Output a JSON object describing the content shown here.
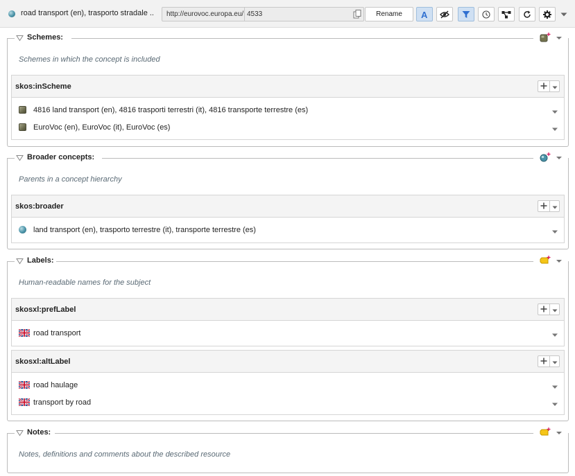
{
  "toolbar": {
    "concept_title": "road transport (en), trasporto stradale ..",
    "uri_base": "http://eurovoc.europa.eu/",
    "uri_id": "4533",
    "rename_label": "Rename",
    "icons": [
      "font-icon",
      "eye-slash-icon",
      "filter-icon",
      "clock-icon",
      "graph-icon",
      "refresh-icon",
      "gear-icon",
      "chevron-down-icon"
    ],
    "active_color": "#cfe0f3"
  },
  "sections": {
    "schemes": {
      "title": "Schemes:",
      "description": "Schemes in which the concept is included",
      "properties": [
        {
          "name": "skos:inScheme",
          "values": [
            "4816 land transport (en), 4816 trasporti terrestri (it), 4816 transporte terrestre (es)",
            "EuroVoc (en), EuroVoc (it), EuroVoc (es)"
          ]
        }
      ]
    },
    "broader": {
      "title": "Broader concepts:",
      "description": "Parents in a concept hierarchy",
      "properties": [
        {
          "name": "skos:broader",
          "values": [
            "land transport (en), trasporto terrestre (it), transporte terrestre (es)"
          ]
        }
      ]
    },
    "labels": {
      "title": "Labels:",
      "description": "Human-readable names for the subject",
      "properties": [
        {
          "name": "skosxl:prefLabel",
          "values": [
            "road transport"
          ]
        },
        {
          "name": "skosxl:altLabel",
          "values": [
            "road haulage",
            "transport by road"
          ]
        }
      ]
    },
    "notes": {
      "title": "Notes:",
      "description": "Notes, definitions and comments about the described resource"
    }
  }
}
